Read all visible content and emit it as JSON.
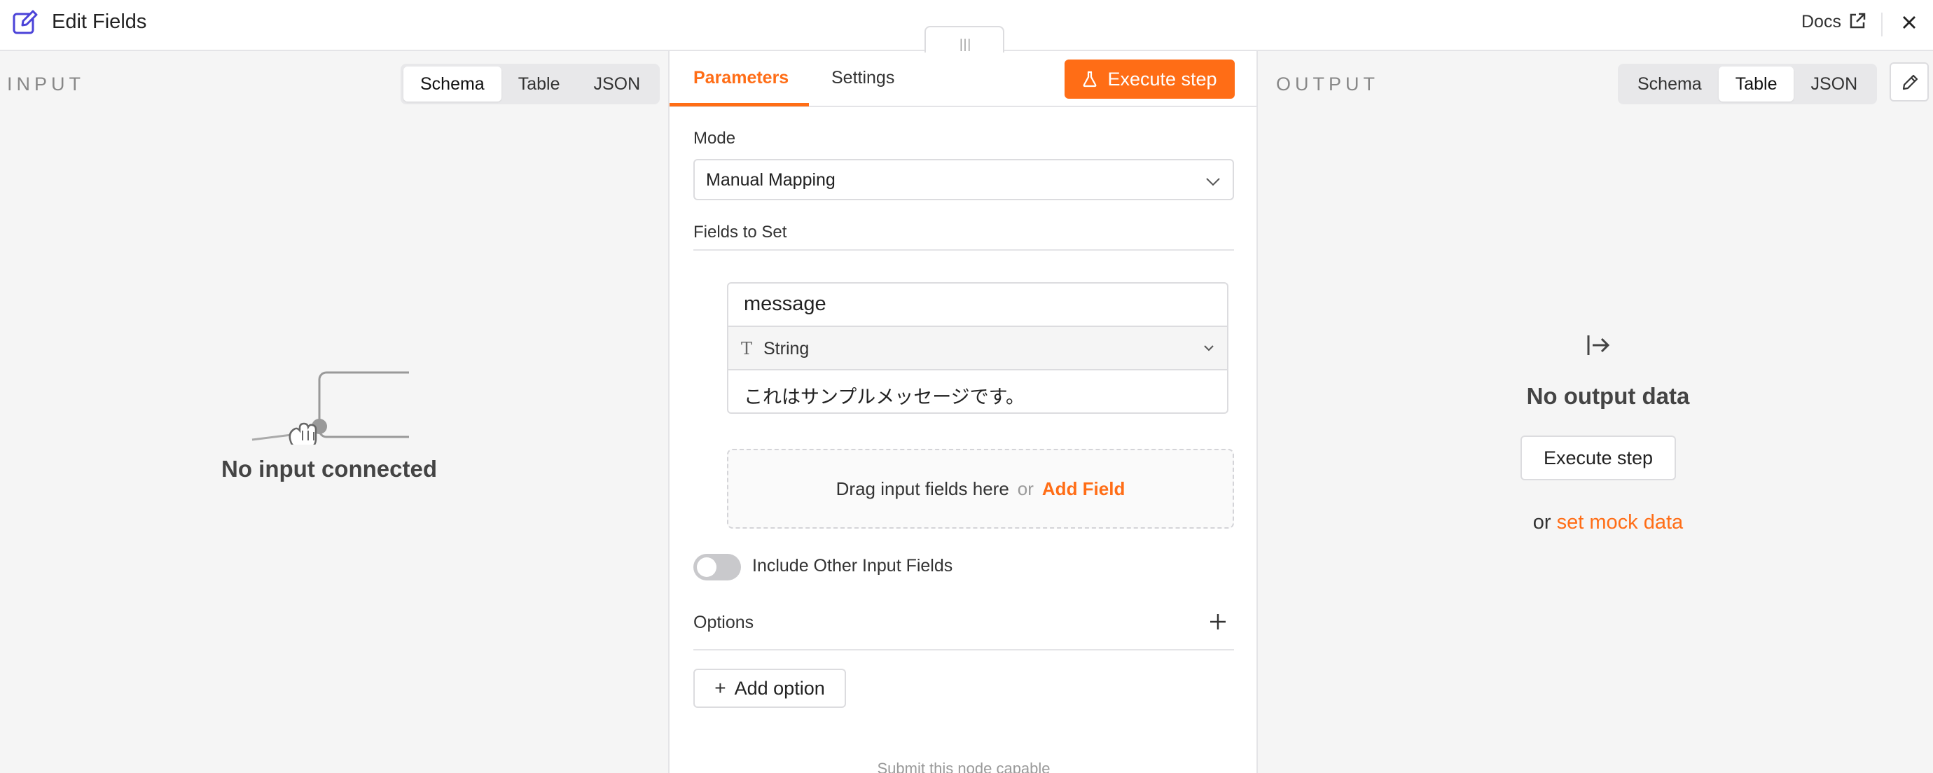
{
  "header": {
    "title": "Edit Fields",
    "title_icon": "edit-square-icon",
    "docs_label": "Docs",
    "docs_icon": "external-link-icon",
    "close_icon": "close-icon",
    "drag_handle_glyph": "|||"
  },
  "input_panel": {
    "label": "INPUT",
    "view_options": [
      "Schema",
      "Table",
      "JSON"
    ],
    "active_view": "Schema",
    "empty_message": "No input connected"
  },
  "parameters_panel": {
    "tabs": [
      "Parameters",
      "Settings"
    ],
    "active_tab": "Parameters",
    "execute_label": "Execute step",
    "execute_icon": "flask-icon",
    "mode_label": "Mode",
    "mode_value": "Manual Mapping",
    "fields_to_set_label": "Fields to Set",
    "assignment": {
      "name": "message",
      "type_icon": "T",
      "type": "String",
      "value": "これはサンプルメッセージです。"
    },
    "dropzone_text": "Drag input fields here",
    "dropzone_or": "or",
    "add_field_label": "Add Field",
    "include_other_label": "Include Other Input Fields",
    "include_other_enabled": false,
    "options_label": "Options",
    "add_option_label": "Add option",
    "bottom_text": "Submit this node capable"
  },
  "output_panel": {
    "label": "OUTPUT",
    "view_options": [
      "Schema",
      "Table",
      "JSON"
    ],
    "active_view": "Table",
    "empty_message": "No output data",
    "execute_label": "Execute step",
    "mock_prefix": "or",
    "mock_link": "set mock data"
  },
  "colors": {
    "accent": "#ff6d16",
    "panel_bg": "#f5f5f5"
  }
}
